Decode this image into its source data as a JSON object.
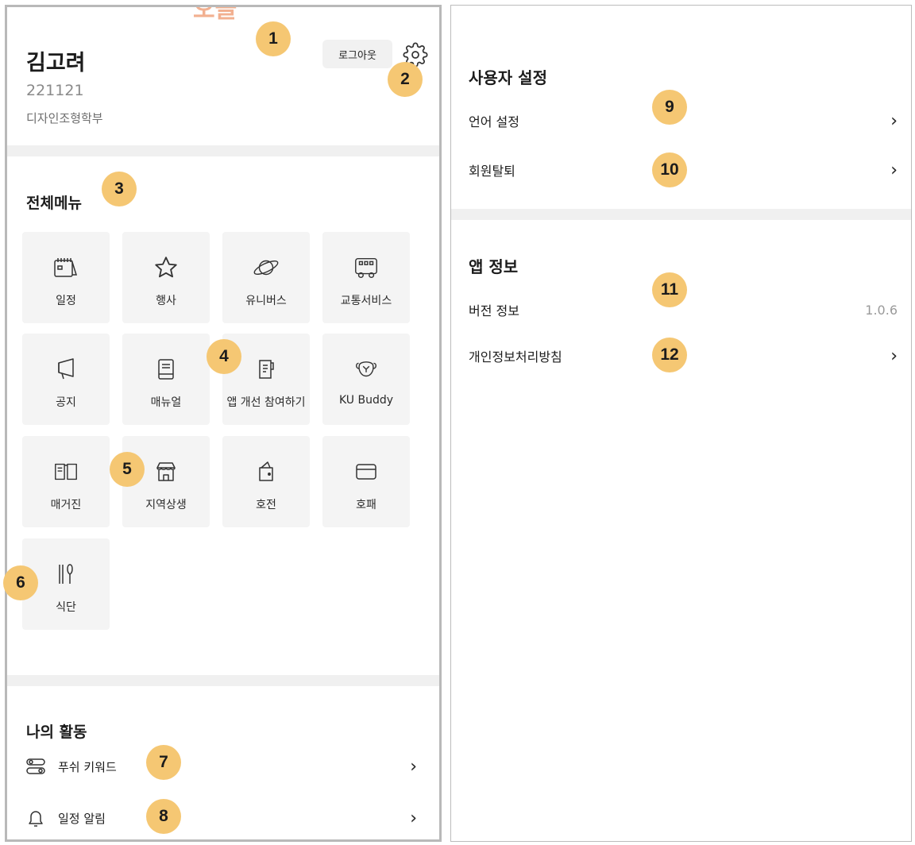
{
  "profile": {
    "top_remnant": "오늘",
    "name": "김고려",
    "student_id": "221121",
    "department": "디자인조형학부",
    "logout_label": "로그아웃",
    "settings_icon": "gear-icon"
  },
  "all_menu": {
    "title": "전체메뉴",
    "tiles": [
      {
        "label": "일정",
        "icon": "calendar-icon"
      },
      {
        "label": "행사",
        "icon": "star-icon"
      },
      {
        "label": "유니버스",
        "icon": "planet-icon"
      },
      {
        "label": "교통서비스",
        "icon": "bus-icon"
      },
      {
        "label": "공지",
        "icon": "megaphone-icon"
      },
      {
        "label": "매뉴얼",
        "icon": "manual-book-icon"
      },
      {
        "label": "앱 개선 참여하기",
        "icon": "feedback-icon"
      },
      {
        "label": "KU Buddy",
        "icon": "tiger-icon"
      },
      {
        "label": "매거진",
        "icon": "open-book-icon"
      },
      {
        "label": "지역상생",
        "icon": "store-icon"
      },
      {
        "label": "호전",
        "icon": "wallet-icon"
      },
      {
        "label": "호패",
        "icon": "card-icon"
      },
      {
        "label": "식단",
        "icon": "utensils-icon"
      }
    ]
  },
  "my_activity": {
    "title": "나의 활동",
    "items": [
      {
        "label": "푸쉬 키워드",
        "icon": "toggle-icon"
      },
      {
        "label": "일정 알림",
        "icon": "bell-icon"
      }
    ]
  },
  "user_settings": {
    "title": "사용자 설정",
    "items": [
      {
        "label": "언어 설정"
      },
      {
        "label": "회원탈퇴"
      }
    ]
  },
  "app_info": {
    "title": "앱 정보",
    "version_label": "버전 정보",
    "version_value": "1.0.6",
    "privacy_label": "개인정보처리방침"
  },
  "chevron": "›",
  "badges": [
    "1",
    "2",
    "3",
    "4",
    "5",
    "6",
    "7",
    "8",
    "9",
    "10",
    "11",
    "12"
  ],
  "colors": {
    "badge": "#f5c773",
    "tile_bg": "#f4f4f4",
    "divider": "#f0f0f0"
  }
}
